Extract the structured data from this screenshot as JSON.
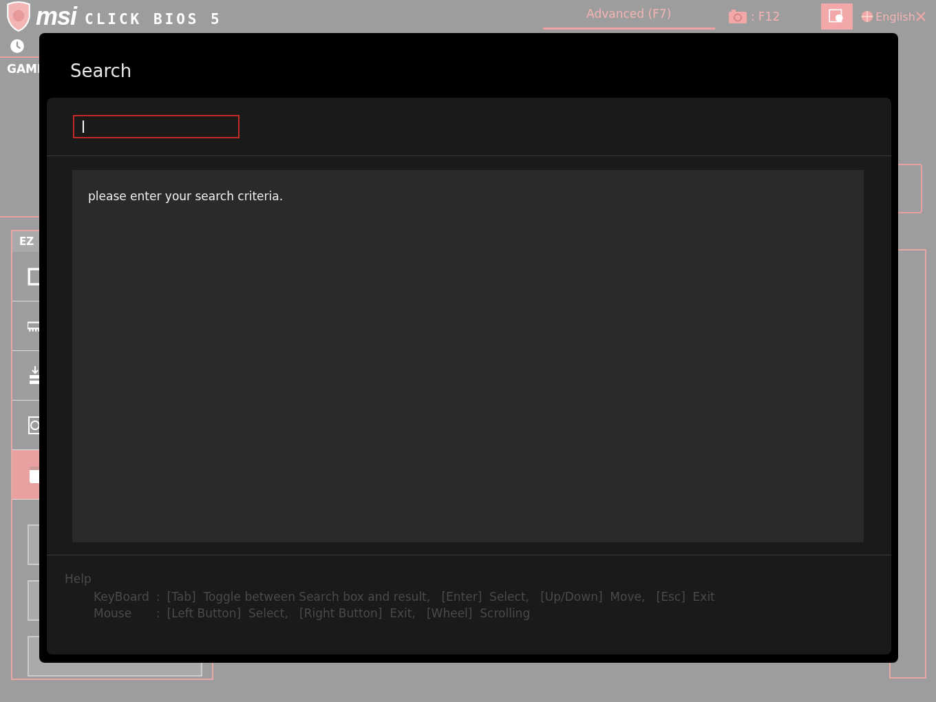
{
  "header": {
    "logo_brand": "msi",
    "logo_product": "CLICK BIOS 5",
    "mode_tab": "Advanced (F7)",
    "screenshot_key": ": F12",
    "language": "English"
  },
  "left_panel": {
    "game_boost_label": "GAMI",
    "ez_label": "EZ",
    "sidebar_items": [
      {
        "kind": "cpu",
        "selected": false
      },
      {
        "kind": "memory",
        "selected": false
      },
      {
        "kind": "storage",
        "selected": false
      },
      {
        "kind": "fan",
        "selected": false
      },
      {
        "kind": "calendar",
        "selected": true
      }
    ]
  },
  "dialog": {
    "title": "Search",
    "search_field": {
      "focused": true
    },
    "results": {
      "message": "please enter your search criteria."
    },
    "help": {
      "title": "Help",
      "lines": [
        {
          "label": "KeyBoard",
          "separator": ":",
          "text": "[Tab]  Toggle between Search box and result,   [Enter]  Select,   [Up/Down]  Move,   [Esc]  Exit"
        },
        {
          "label": "Mouse",
          "separator": ":",
          "text": "[Left Button]  Select,   [Right Button]  Exit,   [Wheel]  Scrolling"
        }
      ]
    }
  }
}
